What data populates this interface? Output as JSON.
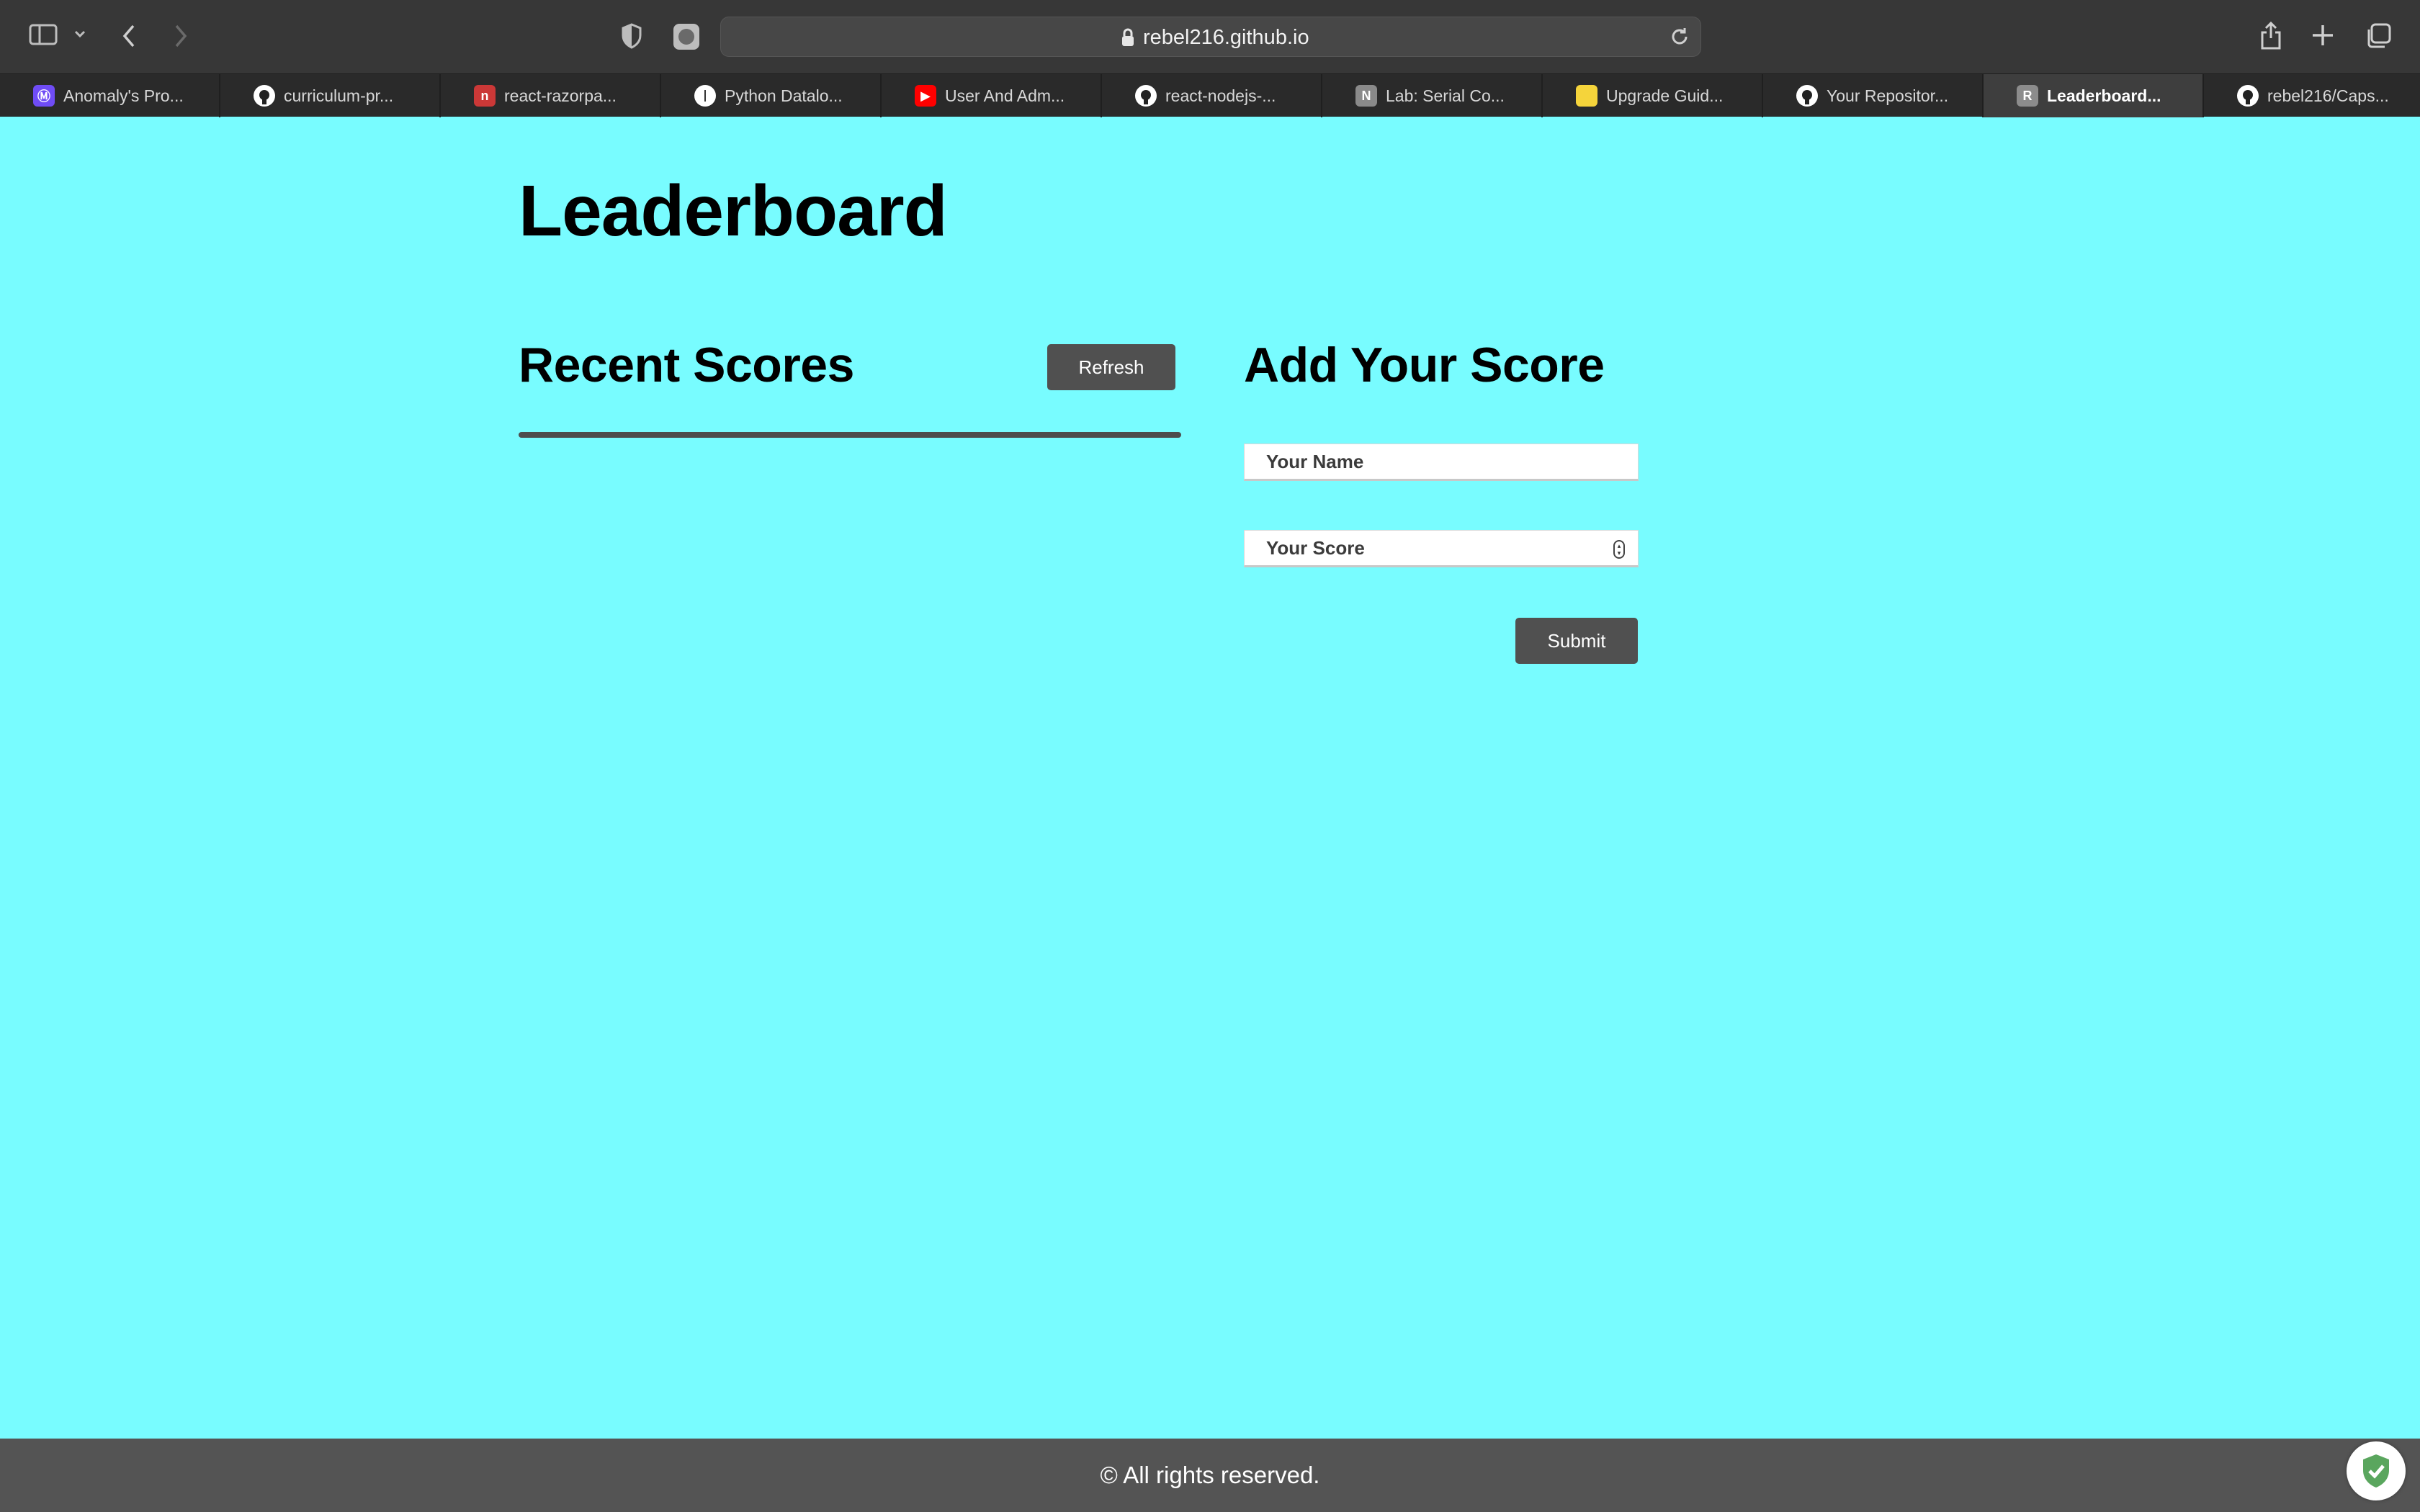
{
  "browser": {
    "url": "rebel216.github.io",
    "tabs": [
      {
        "label": "Anomaly's Pro...",
        "icon": "anomaly-favicon",
        "color": "#6f4cf5",
        "glyph": "Ⓜ",
        "active": false
      },
      {
        "label": "curriculum-pr...",
        "icon": "github-favicon",
        "color": "#ffffff",
        "glyph": "",
        "active": false
      },
      {
        "label": "react-razorpa...",
        "icon": "npm-favicon",
        "color": "#cb3837",
        "glyph": "n",
        "active": false
      },
      {
        "label": "Python Datalo...",
        "icon": "python-favicon",
        "color": "#ffffff",
        "glyph": "",
        "active": false
      },
      {
        "label": "User And Adm...",
        "icon": "youtube-favicon",
        "color": "#ff0000",
        "glyph": "▶",
        "active": false
      },
      {
        "label": "react-nodejs-...",
        "icon": "github-favicon",
        "color": "#ffffff",
        "glyph": "",
        "active": false
      },
      {
        "label": "Lab: Serial Co...",
        "icon": "notion-favicon",
        "color": "#8a8a8a",
        "glyph": "N",
        "active": false
      },
      {
        "label": "Upgrade Guid...",
        "icon": "note-favicon",
        "color": "#f5d43b",
        "glyph": "",
        "active": false
      },
      {
        "label": "Your Repositor...",
        "icon": "github-favicon",
        "color": "#ffffff",
        "glyph": "",
        "active": false
      },
      {
        "label": "Leaderboard...",
        "icon": "letter-r-favicon",
        "color": "#8c8c8c",
        "glyph": "R",
        "active": true
      },
      {
        "label": "rebel216/Caps...",
        "icon": "github-favicon",
        "color": "#ffffff",
        "glyph": "",
        "active": false
      }
    ]
  },
  "page": {
    "title": "Leaderboard",
    "recent_scores_title": "Recent Scores",
    "refresh_label": "Refresh",
    "add_score_title": "Add Your Score",
    "name_placeholder": "Your Name",
    "score_placeholder": "Your Score",
    "submit_label": "Submit",
    "scores": []
  },
  "footer": {
    "text": "© All rights reserved."
  },
  "colors": {
    "background": "#78fcff",
    "button": "#505050",
    "footer": "#545454"
  }
}
